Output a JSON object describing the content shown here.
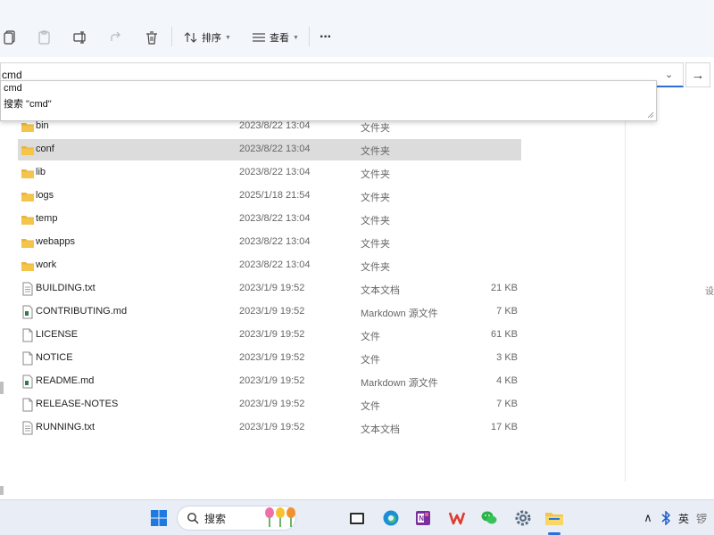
{
  "toolbar": {
    "sort_label": "排序",
    "view_label": "查看",
    "more_label": "···"
  },
  "address": {
    "value": "cmd"
  },
  "suggestions": [
    {
      "label": "cmd"
    },
    {
      "label": "搜索 \"cmd\""
    }
  ],
  "files": [
    {
      "name": "bin",
      "date": "2023/8/22 13:04",
      "type": "文件夹",
      "size": "",
      "icon": "folder-icon",
      "selected": false
    },
    {
      "name": "conf",
      "date": "2023/8/22 13:04",
      "type": "文件夹",
      "size": "",
      "icon": "folder-icon",
      "selected": true
    },
    {
      "name": "lib",
      "date": "2023/8/22 13:04",
      "type": "文件夹",
      "size": "",
      "icon": "folder-icon",
      "selected": false
    },
    {
      "name": "logs",
      "date": "2025/1/18 21:54",
      "type": "文件夹",
      "size": "",
      "icon": "folder-icon",
      "selected": false
    },
    {
      "name": "temp",
      "date": "2023/8/22 13:04",
      "type": "文件夹",
      "size": "",
      "icon": "folder-icon",
      "selected": false
    },
    {
      "name": "webapps",
      "date": "2023/8/22 13:04",
      "type": "文件夹",
      "size": "",
      "icon": "folder-icon",
      "selected": false
    },
    {
      "name": "work",
      "date": "2023/8/22 13:04",
      "type": "文件夹",
      "size": "",
      "icon": "folder-icon",
      "selected": false
    },
    {
      "name": "BUILDING.txt",
      "date": "2023/1/9 19:52",
      "type": "文本文档",
      "size": "21 KB",
      "icon": "text-file-icon",
      "selected": false
    },
    {
      "name": "CONTRIBUTING.md",
      "date": "2023/1/9 19:52",
      "type": "Markdown 源文件",
      "size": "7 KB",
      "icon": "markdown-file-icon",
      "selected": false
    },
    {
      "name": "LICENSE",
      "date": "2023/1/9 19:52",
      "type": "文件",
      "size": "61 KB",
      "icon": "file-icon",
      "selected": false
    },
    {
      "name": "NOTICE",
      "date": "2023/1/9 19:52",
      "type": "文件",
      "size": "3 KB",
      "icon": "file-icon",
      "selected": false
    },
    {
      "name": "README.md",
      "date": "2023/1/9 19:52",
      "type": "Markdown 源文件",
      "size": "4 KB",
      "icon": "markdown-file-icon",
      "selected": false
    },
    {
      "name": "RELEASE-NOTES",
      "date": "2023/1/9 19:52",
      "type": "文件",
      "size": "7 KB",
      "icon": "file-icon",
      "selected": false
    },
    {
      "name": "RUNNING.txt",
      "date": "2023/1/9 19:52",
      "type": "文本文档",
      "size": "17 KB",
      "icon": "text-file-icon",
      "selected": false
    }
  ],
  "edge_text": "设",
  "taskbar": {
    "search_label": "搜索",
    "tray_ime": "英",
    "tray_clock_partial": "锣"
  },
  "colors": {
    "accent": "#2b6fd6",
    "folder": "#f4c54a",
    "selected_row": "#dcdcdc"
  }
}
